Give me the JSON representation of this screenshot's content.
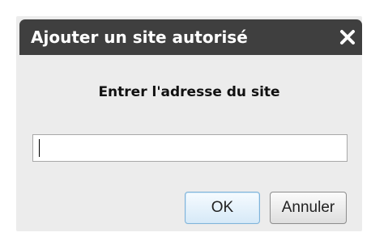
{
  "dialog": {
    "title": "Ajouter un site autorisé",
    "close_icon": "close-icon",
    "prompt": "Entrer l'adresse du site",
    "input": {
      "value": "",
      "placeholder": ""
    },
    "ok_label": "OK",
    "cancel_label": "Annuler"
  },
  "colors": {
    "titlebar": "#3f3f3f",
    "dialog_background": "#ececec",
    "ok_border": "#7fb3d9"
  }
}
